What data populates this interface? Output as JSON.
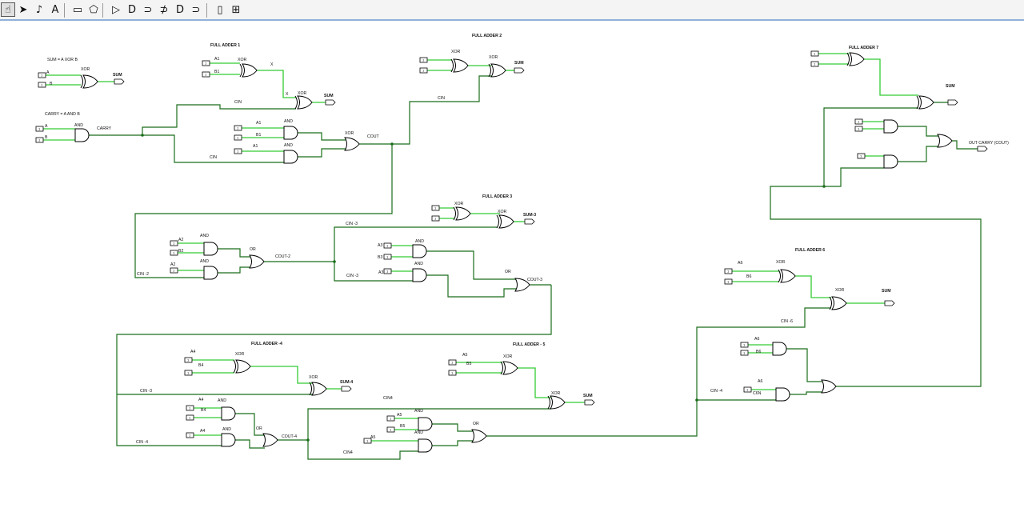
{
  "toolbar": {
    "tools": [
      {
        "name": "poke-tool-icon",
        "glyph": "☝"
      },
      {
        "name": "select-tool-icon",
        "glyph": "➤"
      },
      {
        "name": "wiring-tool-icon",
        "glyph": "♪"
      },
      {
        "name": "text-tool-icon",
        "glyph": "A"
      },
      {
        "name": "input-pin-icon",
        "glyph": "▭"
      },
      {
        "name": "output-pin-icon",
        "glyph": "⬠"
      },
      {
        "name": "not-gate-icon",
        "glyph": "▷"
      },
      {
        "name": "and-gate-icon",
        "glyph": "D"
      },
      {
        "name": "or-gate-icon",
        "glyph": "⊃"
      },
      {
        "name": "xor-gate-icon",
        "glyph": "⊅"
      },
      {
        "name": "nand-gate-icon",
        "glyph": "D"
      },
      {
        "name": "nor-gate-icon",
        "glyph": "⊃"
      },
      {
        "name": "subcircuit-icon",
        "glyph": "▯"
      },
      {
        "name": "splitter-icon",
        "glyph": "⊞"
      }
    ]
  },
  "colors": {
    "wire_on": "#33cc33",
    "wire_off": "#1a6e1a",
    "toolbar_border": "#8fb2d9"
  },
  "circuit": {
    "labels": {
      "half_sum_formula": "SUM = A XOR B",
      "half_carry_formula": "CARRY = A AND B",
      "fa1_title": "FULL ADDER 1",
      "fa2_title": "FULL ADDER 2",
      "fa3_title": "FULL ADDER 3",
      "fa4_title": "FULL ADDER -4",
      "fa5_title": "FULL ADDER - 5",
      "fa6_title": "FULL ADDER 6",
      "fa7_title": "FULL ADDER 7",
      "xor": "XOR",
      "and": "AND",
      "or": "OR",
      "sum": "SUM",
      "carry": "CARRY",
      "cin": "CIN",
      "cout": "COUT",
      "x": "X",
      "a": "A",
      "b": "B",
      "a1": "A1",
      "b1": "B1",
      "a2": "A2",
      "b2": "B2",
      "a3": "A3",
      "b3": "B3",
      "a4": "A4",
      "b4": "B4",
      "a5": "A5",
      "b5": "B5",
      "a6": "A6",
      "b6": "B6",
      "c6n": "C6N",
      "cin2": "CIN -2",
      "cin3": "CIN -3",
      "cin3b": "CIN -3",
      "cin3c": "CIN -3",
      "cin4": "CIN4",
      "cin6": "CIN -6",
      "cin_dash4": "CIN -4",
      "cout2": "COUT-2",
      "cout3": "COUT-3",
      "cout4": "COUT-4",
      "sum3": "SUM-3",
      "sum4": "SUM-4",
      "out_carry": "OUT CARRY (COUT)",
      "pin_in": "0",
      "pin_on": "1"
    }
  }
}
